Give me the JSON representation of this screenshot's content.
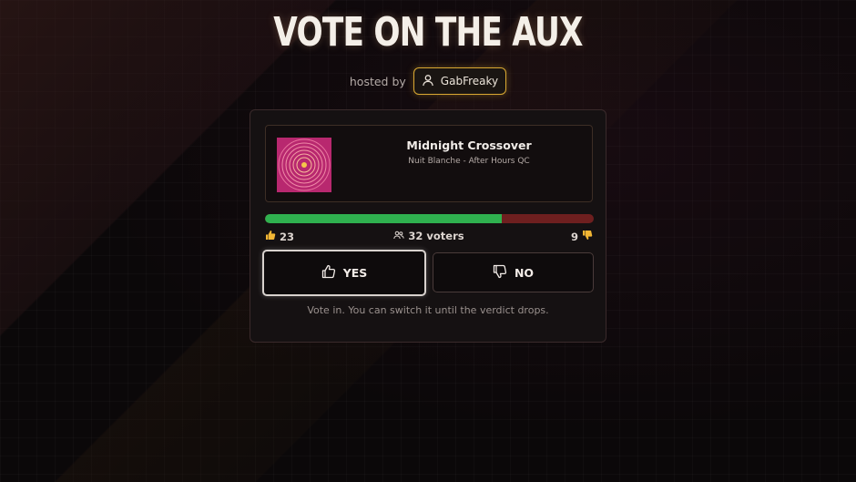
{
  "header": {
    "title": "VOTE ON THE AUX",
    "hosted_by_label": "hosted by",
    "host_name": "GabFreaky",
    "host_icon": "user-icon"
  },
  "track": {
    "title": "Midnight Crossover",
    "subtitle": "Nuit Blanche - After Hours QC",
    "art_icon": "vinyl-record-icon"
  },
  "tally": {
    "yes_count": "23",
    "voters_label": "32 voters",
    "no_count": "9",
    "yes_fraction": 0.72,
    "yes_color": "#2fb14f",
    "no_color": "#6e1f1f"
  },
  "buttons": {
    "yes_label": "YES",
    "no_label": "NO",
    "selected": "yes"
  },
  "hint": "Vote in. You can switch it until the verdict drops.",
  "colors": {
    "accent": "#d9a832",
    "background": "#0b0809"
  }
}
